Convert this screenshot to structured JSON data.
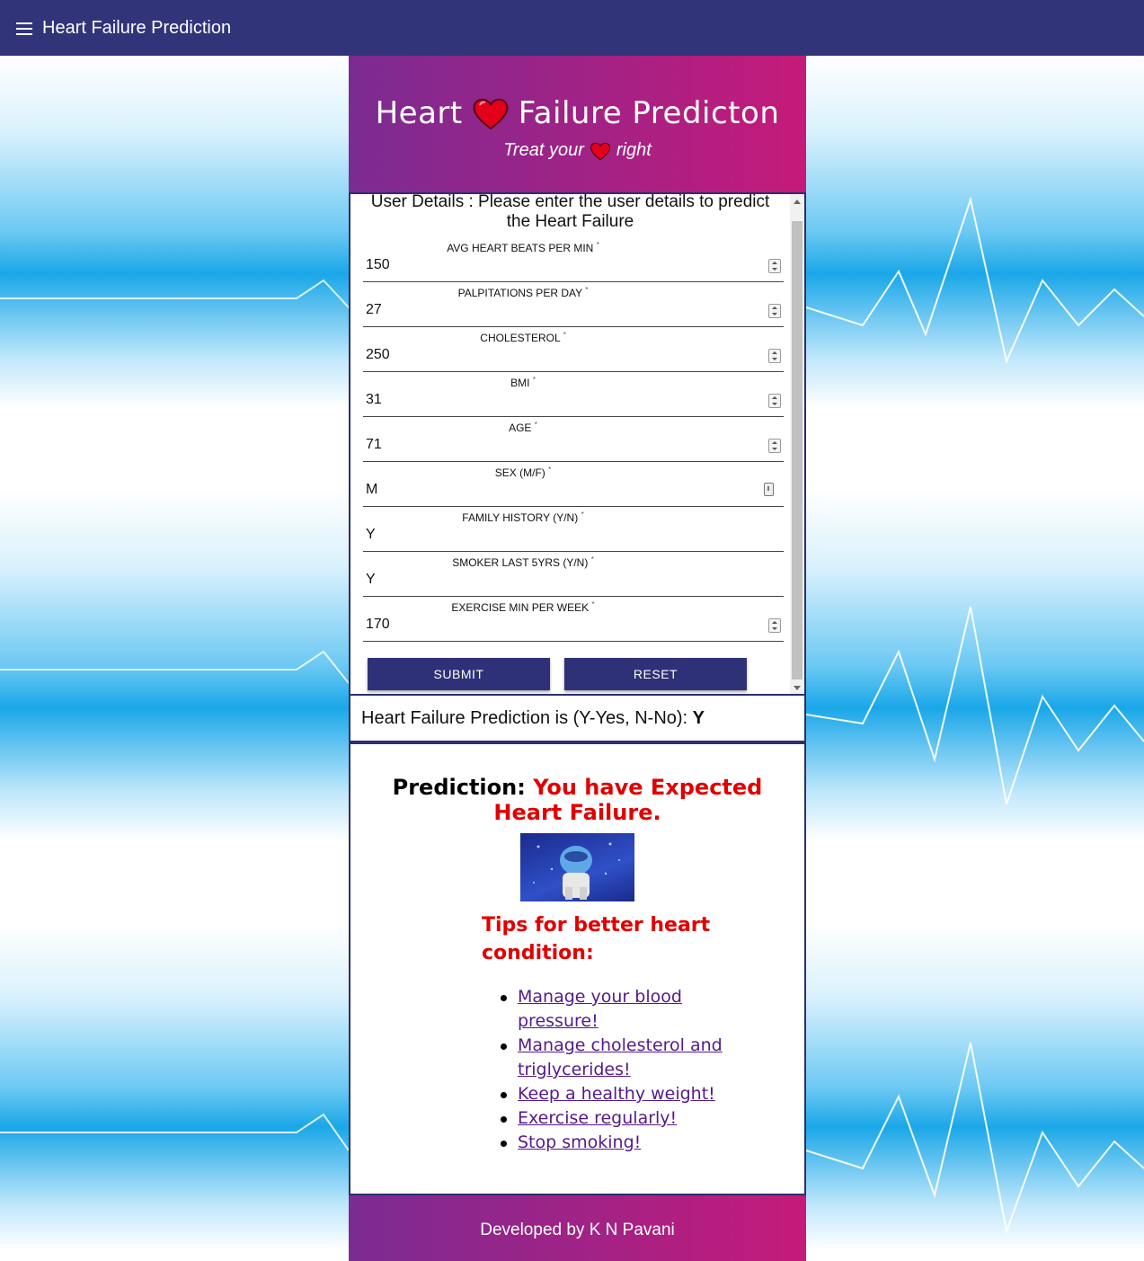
{
  "topbar": {
    "title": "Heart Failure Prediction",
    "menu_icon": "hamburger-menu-icon"
  },
  "hero": {
    "title_left": "Heart",
    "title_right": "Failure Predicton",
    "subtitle_left": "Treat your",
    "subtitle_right": "right",
    "heart_color": "#e3001b"
  },
  "form": {
    "heading": "User Details : Please enter the user details to predict the Heart Failure",
    "fields": [
      {
        "label": "AVG HEART BEATS PER MIN",
        "value": "150",
        "required_mark": "*"
      },
      {
        "label": "PALPITATIONS PER DAY",
        "value": "27",
        "required_mark": "*"
      },
      {
        "label": "CHOLESTEROL",
        "value": "250",
        "required_mark": "*"
      },
      {
        "label": "BMI",
        "value": "31",
        "required_mark": "*"
      },
      {
        "label": "AGE",
        "value": "71",
        "required_mark": "*"
      },
      {
        "label": "SEX (M/F)",
        "value": "M",
        "required_mark": "*"
      },
      {
        "label": "FAMILY HISTORY (Y/N)",
        "value": "Y",
        "required_mark": "*"
      },
      {
        "label": "SMOKER LAST 5YRS (Y/N)",
        "value": "Y",
        "required_mark": "*"
      },
      {
        "label": "EXERCISE MIN PER WEEK",
        "value": "170",
        "required_mark": "*"
      }
    ],
    "submit_label": "SUBMIT",
    "reset_label": "RESET"
  },
  "result": {
    "label": "Heart Failure Prediction is (Y-Yes, N-No):",
    "value": "Y"
  },
  "prediction": {
    "prefix": "Prediction:",
    "message": "You have Expected Heart Failure.",
    "tips_title": "Tips for better heart condition:",
    "tips": [
      "Manage your blood pressure!",
      "Manage cholesterol and triglycerides!",
      "Keep a healthy weight!",
      "Exercise regularly!",
      "Stop smoking!"
    ]
  },
  "footer": {
    "text": "Developed by K N Pavani"
  },
  "colors": {
    "topbar": "#32347a",
    "accent_gradient_start": "#7b2b92",
    "accent_gradient_end": "#c51a7a",
    "button": "#2e3178",
    "alert_red": "#e00000"
  }
}
